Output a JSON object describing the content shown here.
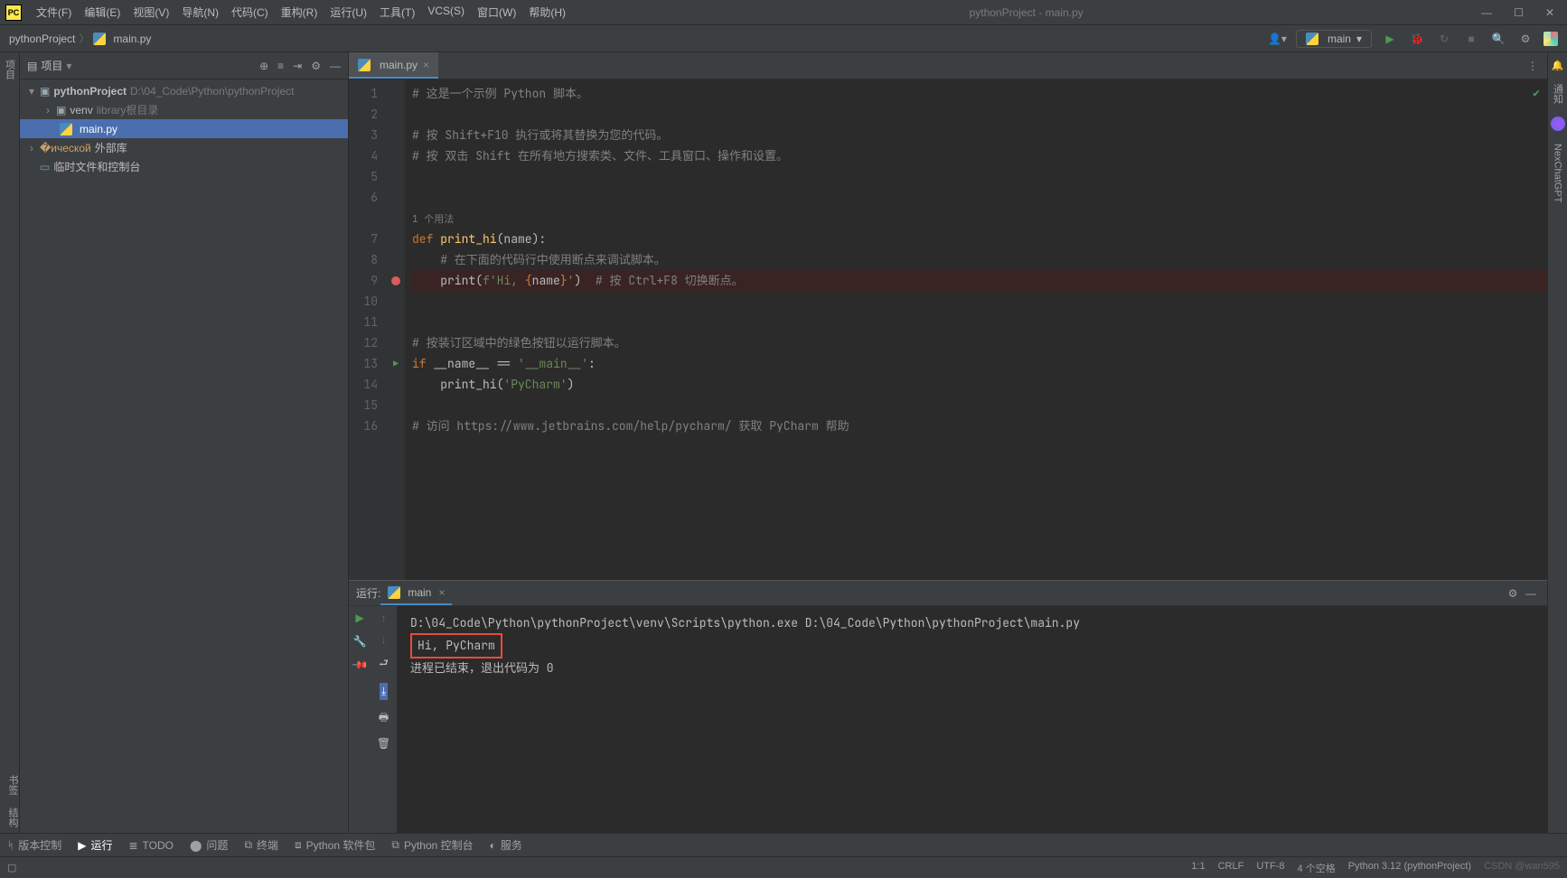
{
  "window": {
    "title": "pythonProject - main.py"
  },
  "menu": {
    "file": "文件(F)",
    "edit": "编辑(E)",
    "view": "视图(V)",
    "nav": "导航(N)",
    "code": "代码(C)",
    "refactor": "重构(R)",
    "run": "运行(U)",
    "tools": "工具(T)",
    "vcs": "VCS(S)",
    "window": "窗口(W)",
    "help": "帮助(H)"
  },
  "breadcrumb": {
    "project": "pythonProject",
    "file": "main.py"
  },
  "runConfig": {
    "label": "main"
  },
  "projectPanel": {
    "title": "项目",
    "root": "pythonProject",
    "rootPath": "D:\\04_Code\\Python\\pythonProject",
    "venv": "venv",
    "venvHint": "library根目录",
    "mainFile": "main.py",
    "externalLibs": "外部库",
    "scratches": "临时文件和控制台"
  },
  "leftGutter": {
    "project": "项目",
    "structure": "结构",
    "bookmarks": "书签"
  },
  "rightGutter": {
    "notifications": "通知",
    "chat": "NexChatGPT"
  },
  "tabs": {
    "main": "main.py"
  },
  "code": {
    "l1": "# 这是一个示例 Python 脚本。",
    "l3": "# 按 Shift+F10 执行或将其替换为您的代码。",
    "l4": "# 按 双击 Shift 在所有地方搜索类、文件、工具窗口、操作和设置。",
    "usage": "1 个用法",
    "def": "def ",
    "fnName": "print_hi",
    "params": "(name):",
    "l8": "    # 在下面的代码行中使用断点来调试脚本。",
    "l9a": "    print(",
    "l9b": "f'Hi, ",
    "l9c": "{",
    "l9d": "name",
    "l9e": "}",
    "l9f": "'",
    "l9g": ")  ",
    "l9h": "# 按 Ctrl+F8 切换断点。",
    "l12": "# 按装订区域中的绿色按钮以运行脚本。",
    "if": "if ",
    "dname": "__name__",
    "eq": " == ",
    "mainstr": "'__main__'",
    "colon": ":",
    "l14a": "    print_hi(",
    "l14b": "'PyCharm'",
    "l14c": ")",
    "l16": "# 访问 https://www.jetbrains.com/help/pycharm/ 获取 PyCharm 帮助"
  },
  "lineNumbers": [
    "1",
    "2",
    "3",
    "4",
    "5",
    "6",
    "",
    "7",
    "8",
    "9",
    "10",
    "11",
    "12",
    "13",
    "14",
    "15",
    "16"
  ],
  "runPanel": {
    "title": "运行:",
    "tab": "main",
    "line1": "D:\\04_Code\\Python\\pythonProject\\venv\\Scripts\\python.exe D:\\04_Code\\Python\\pythonProject\\main.py",
    "line2": "Hi, PyCharm",
    "line3": "进程已结束，退出代码为 0"
  },
  "bottomTools": {
    "vcs": "版本控制",
    "run": "运行",
    "todo": "TODO",
    "problems": "问题",
    "terminal": "终端",
    "packages": "Python 软件包",
    "console": "Python 控制台",
    "services": "服务"
  },
  "status": {
    "pos": "1:1",
    "crlf": "CRLF",
    "enc": "UTF-8",
    "indent": "4 个空格",
    "interp": "Python 3.12 (pythonProject)",
    "watermark": "CSDN @wan595"
  }
}
